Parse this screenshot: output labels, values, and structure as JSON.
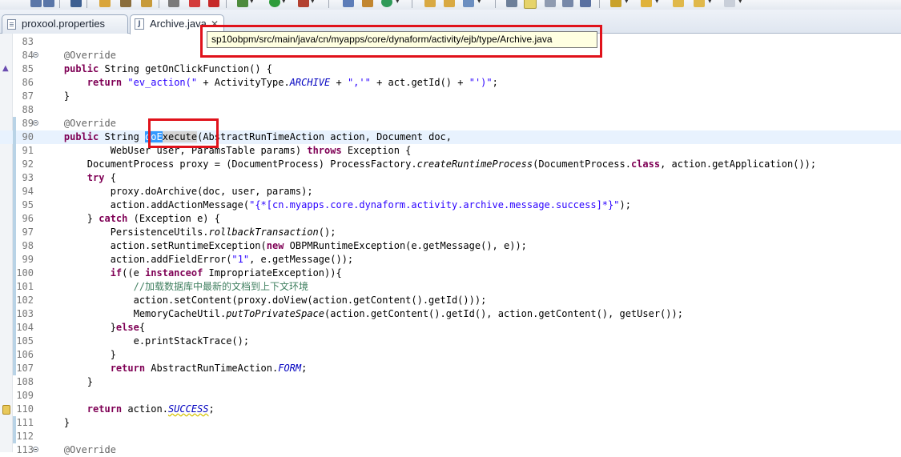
{
  "tabs": [
    {
      "label": "proxool.properties",
      "close": ""
    },
    {
      "label": "Archive.java",
      "close": "✕"
    }
  ],
  "tooltip": "sp10obpm/src/main/java/cn/myapps/core/dynaform/activity/ejb/type/Archive.java",
  "file_icon_letter": "J",
  "lines": [
    {
      "n": "83",
      "html": ""
    },
    {
      "n": "84",
      "html": "    <span class=\"ann\">@Override</span>"
    },
    {
      "n": "85",
      "html": "    <span class=\"kw\">public</span> String getOnClickFunction() {"
    },
    {
      "n": "86",
      "html": "        <span class=\"kw\">return</span> <span class=\"str\">\"ev_action(\"</span> + ActivityType.<span class=\"field\">ARCHIVE</span> + <span class=\"str\">\",'\"</span> + <span class=\"fld\">act</span>.getId() + <span class=\"str\">\"')\"</span>;"
    },
    {
      "n": "87",
      "html": "    }"
    },
    {
      "n": "88",
      "html": ""
    },
    {
      "n": "89",
      "html": "    <span class=\"ann\">@Override</span>"
    },
    {
      "n": "90",
      "html": "    <span class=\"kw\">public</span> String <span class=\"sel\">doE</span><span class=\"occ\">xecute</span>(AbstractRunTimeAction action, Document doc,"
    },
    {
      "n": "91",
      "html": "            WebUser user, ParamsTable params) <span class=\"kw\">throws</span> Exception {"
    },
    {
      "n": "92",
      "html": "        DocumentProcess proxy = (DocumentProcess) ProcessFactory.<span class=\"smeth\">createRuntimeProcess</span>(DocumentProcess.<span class=\"kw\">class</span>, action.getApplication());"
    },
    {
      "n": "93",
      "html": "        <span class=\"kw\">try</span> {"
    },
    {
      "n": "94",
      "html": "            proxy.doArchive(doc, user, params);"
    },
    {
      "n": "95",
      "html": "            action.addActionMessage(<span class=\"str\">\"{*[cn.myapps.core.dynaform.activity.archive.message.success]*}\"</span>);"
    },
    {
      "n": "96",
      "html": "        } <span class=\"kw\">catch</span> (Exception e) {"
    },
    {
      "n": "97",
      "html": "            PersistenceUtils.<span class=\"smeth\">rollbackTransaction</span>();"
    },
    {
      "n": "98",
      "html": "            action.setRuntimeException(<span class=\"kw\">new</span> OBPMRuntimeException(e.getMessage(), e));"
    },
    {
      "n": "99",
      "html": "            action.addFieldError(<span class=\"str\">\"1\"</span>, e.getMessage());"
    },
    {
      "n": "100",
      "html": "            <span class=\"kw\">if</span>((e <span class=\"kw\">instanceof</span> ImpropriateException)){"
    },
    {
      "n": "101",
      "html": "                <span class=\"cmt\">//加载数据库中最新的文档到上下文环境</span>"
    },
    {
      "n": "102",
      "html": "                action.setContent(proxy.doView(action.getContent().getId()));"
    },
    {
      "n": "103",
      "html": "                MemoryCacheUtil.<span class=\"smeth\">putToPrivateSpace</span>(action.getContent().getId(), action.getContent(), getUser());"
    },
    {
      "n": "104",
      "html": "            }<span class=\"kw\">else</span>{"
    },
    {
      "n": "105",
      "html": "                e.printStackTrace();"
    },
    {
      "n": "106",
      "html": "            }"
    },
    {
      "n": "107",
      "html": "            <span class=\"kw\">return</span> AbstractRunTimeAction.<span class=\"field\">FORM</span>;"
    },
    {
      "n": "108",
      "html": "        }"
    },
    {
      "n": "109",
      "html": ""
    },
    {
      "n": "110",
      "html": "        <span class=\"kw\">return</span> action.<span class=\"field warn\">SUCCESS</span>;"
    },
    {
      "n": "111",
      "html": "    }"
    },
    {
      "n": "112",
      "html": ""
    },
    {
      "n": "113",
      "html": "    <span class=\"ann\">@Override</span>"
    }
  ],
  "folded_lines": [
    "84",
    "89",
    "113"
  ],
  "current_line": "90",
  "override_marker_lines": [
    "85"
  ],
  "warning_marker_lines": [
    "90",
    "110"
  ],
  "colors": {
    "keyword": "#7f0055",
    "string": "#2a00ff",
    "annotation": "#646464",
    "static_field": "#0000c0",
    "comment": "#3f7f5f",
    "selection": "#3399ff",
    "highlight_box": "#e0121b",
    "tooltip_bg": "#ffffe1"
  }
}
